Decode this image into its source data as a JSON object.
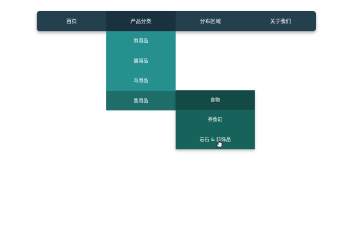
{
  "navbar": {
    "items": [
      {
        "label": "首页"
      },
      {
        "label": "产品分类"
      },
      {
        "label": "分布区域"
      },
      {
        "label": "关于我们"
      }
    ]
  },
  "submenu": {
    "items": [
      {
        "label": "狗用品"
      },
      {
        "label": "猫用品"
      },
      {
        "label": "鸟用品"
      },
      {
        "label": "鱼用品"
      }
    ]
  },
  "submenu2": {
    "items": [
      {
        "label": "食物"
      },
      {
        "label": "养鱼缸"
      },
      {
        "label": "岩石 & 装饰品"
      }
    ]
  },
  "colors": {
    "navbar_bg": "#24404f",
    "navbar_active": "#1a3140",
    "submenu_bg": "#25908e",
    "submenu_active": "#1f6d68",
    "submenu2_bg": "#17625a",
    "submenu2_first": "#134a45"
  },
  "icons": {
    "cursor": "hand-pointer-icon"
  }
}
